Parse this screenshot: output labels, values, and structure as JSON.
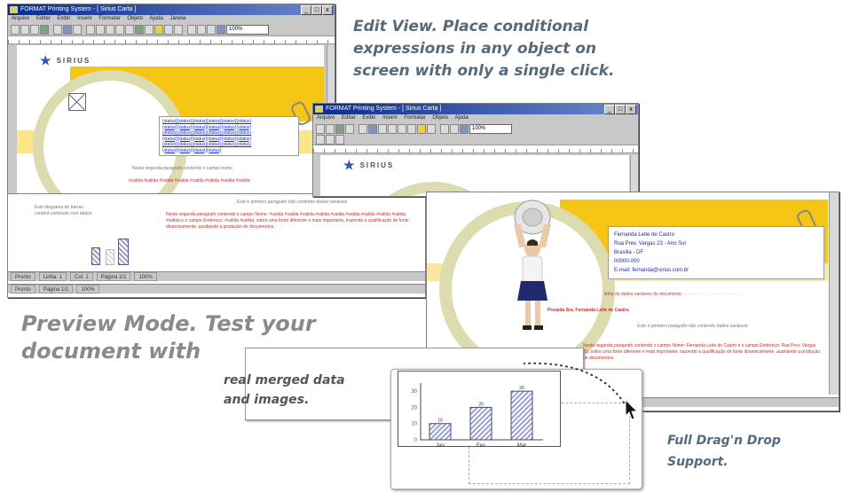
{
  "captions": {
    "edit_view": "Edit View. Place conditional\nexpressions in any object on\nscreen with only a single click.",
    "preview_mode": "Preview Mode. Test your\ndocument with",
    "merged": "real merged data\nand images.",
    "drag": "Full Drag'n Drop\nSupport."
  },
  "app": {
    "window_title": "FORMAT Printing System - [ Sirius Carta ]",
    "menu": [
      "Arquivo",
      "Editar",
      "Exibir",
      "Inserir",
      "Formatar",
      "Objeto",
      "Ajuda",
      "Janela"
    ],
    "zoom": "100%"
  },
  "edit_window": {
    "logo": "SIRIUS",
    "links": [
      "{status}{status}{status}{status}{status}{status}",
      "{status}{status}{status}{status}{status}{status}",
      "{status}{status}{status}{status}{status}{status}",
      "{status}{status}{status}{status}{status}{status}",
      "{status}{status}{status}{status}{status}{status}",
      "{status}{status}{status}{status}"
    ],
    "red_row": "#valida #valida #valida #valida #valida #valida #valida #valida",
    "grey_para": "Nesta segunda paragrafo contendo o campo nome",
    "intro": "Este é primeiro parágrafo não contendo dados variáveis",
    "body": "Nesta segunda paragrafo contendo o campo Nome: #valida #valida #valida #valida #valida #valida #valida #valida #valida #valida e o campo Endereço: #valida #valida, sobre uma fonte diferente e mais importante, trazendo a qualificação de fonte dinamicamente, auxiliando a produção de documentos.",
    "status": [
      "Pronto",
      "Linha: 1",
      "Col: 1",
      "Página 1/1",
      "100%"
    ]
  },
  "second_window": {
    "logo": "SIRIUS"
  },
  "preview_window": {
    "address": [
      "Fernanda Leite de Castro",
      "Rua Prev. Vargas 23 - Ano Sul",
      "Brasilia - DF",
      "00000-000",
      "E-mail: fernanda@sirius.com.br"
    ],
    "salutation": "Prezada Sra. Fernanda Leite de Castro.",
    "intro": "Este é primeiro parágrafo não contendo dados variáveis.",
    "body": "Nesta segunda paragrafo contendo o campo Nome: Fernanda Leite de Castro e o campo Endereço: Rua Prev. Vargas 23, sobre uma fonte diferente e mais importante, trazendo a qualificação de fonte dinamicamente, auxiliando a produção de documentos.",
    "status": [
      "Pronto",
      "Página 1/1",
      "100%"
    ]
  },
  "chart_data": {
    "type": "bar",
    "categories": [
      "Jan",
      "Fev",
      "Mar"
    ],
    "values": [
      10,
      20,
      30
    ],
    "ylim": [
      0,
      35
    ],
    "yticks": [
      "30",
      "20",
      "10",
      "0"
    ]
  }
}
